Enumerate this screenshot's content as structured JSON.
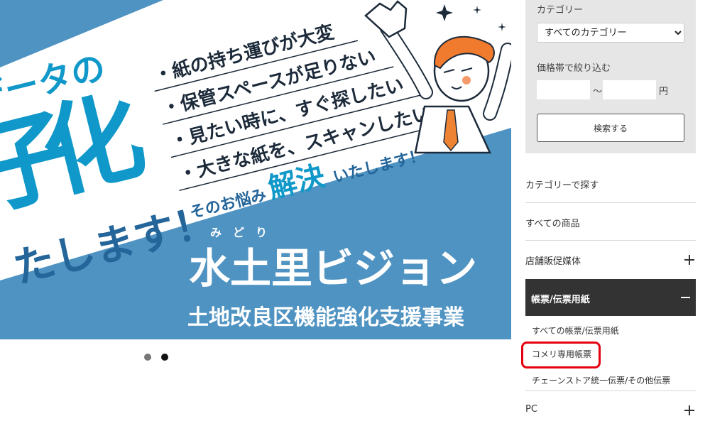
{
  "banner": {
    "headline_part1": "データの",
    "headline_part2": "化",
    "headline_partial_char": "子",
    "headline_end": "たします！",
    "bullets": [
      "・紙の持ち運びが大変",
      "・保管スペースが足りない",
      "・見たい時に、すぐ探したい",
      "・大きな紙を、スキャンしたい"
    ],
    "solve_prefix": "そのお悩み",
    "solve_emphasis": "解決",
    "solve_suffix": "いたします！",
    "company_ruby": "み　ど　り",
    "company_name": "水土里ビジョン",
    "project_name": "土地改良区機能強化支援事業",
    "colors": {
      "light_band": "#4f93c2",
      "accent_cyan": "#0f98c9",
      "text_dark": "#1c2a3a",
      "person_hair": "#f07a2e",
      "person_tie": "#ee8433"
    }
  },
  "carousel": {
    "dot_count": 2,
    "active_index": 1
  },
  "filter": {
    "category_label": "カテゴリー",
    "category_selected": "すべてのカテゴリー",
    "price_label": "価格帯で絞り込む",
    "price_min_value": "",
    "price_max_value": "",
    "price_separator": "〜",
    "price_unit": "円",
    "search_button_label": "検索する"
  },
  "nav": {
    "category_heading": "カテゴリーで探す",
    "all_products": "すべての商品",
    "store_media": "店舗販促媒体",
    "forms": "帳票/伝票用紙",
    "forms_sub": [
      "すべての帳票/伝票用紙",
      "コメリ専用帳票",
      "チェーンストア統一伝票/その他伝票"
    ],
    "pc": "PC",
    "highlight_color": "#e50010"
  }
}
